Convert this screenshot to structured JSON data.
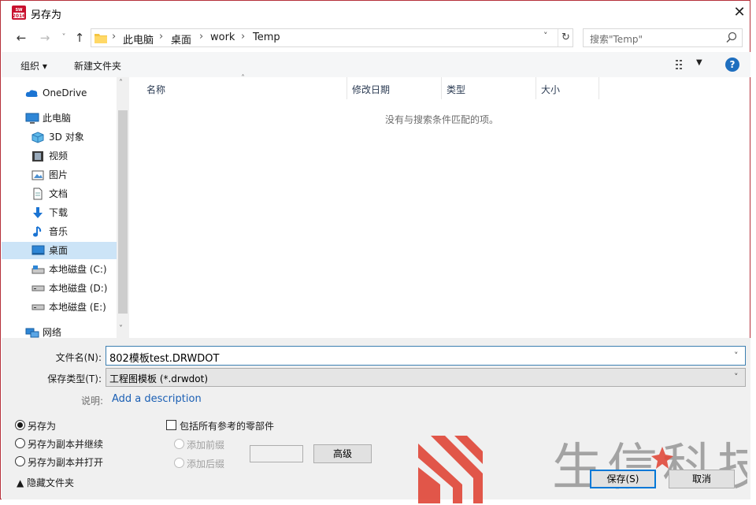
{
  "window": {
    "title": "另存为",
    "app_badge": "SW 2016"
  },
  "nav": {
    "breadcrumb": [
      "此电脑",
      "桌面",
      "work",
      "Temp"
    ],
    "search_placeholder": "搜索\"Temp\""
  },
  "toolbar": {
    "organize_label": "组织",
    "new_folder_label": "新建文件夹"
  },
  "sidebar": {
    "items": [
      {
        "label": "OneDrive",
        "icon": "cloud-icon"
      },
      {
        "label": "此电脑",
        "icon": "computer-icon"
      },
      {
        "label": "3D 对象",
        "icon": "3d-objects-icon"
      },
      {
        "label": "视频",
        "icon": "video-icon"
      },
      {
        "label": "图片",
        "icon": "pictures-icon"
      },
      {
        "label": "文档",
        "icon": "documents-icon"
      },
      {
        "label": "下载",
        "icon": "download-icon"
      },
      {
        "label": "音乐",
        "icon": "music-icon"
      },
      {
        "label": "桌面",
        "icon": "desktop-icon"
      },
      {
        "label": "本地磁盘 (C:)",
        "icon": "drive-c-icon"
      },
      {
        "label": "本地磁盘 (D:)",
        "icon": "drive-icon"
      },
      {
        "label": "本地磁盘 (E:)",
        "icon": "drive-icon"
      },
      {
        "label": "网络",
        "icon": "network-icon"
      }
    ]
  },
  "file_list": {
    "columns": [
      "名称",
      "修改日期",
      "类型",
      "大小"
    ],
    "empty_message": "没有与搜索条件匹配的项。"
  },
  "form": {
    "filename_label": "文件名(N):",
    "filename_value": "802模板test.DRWDOT",
    "filetype_label": "保存类型(T):",
    "filetype_value": "工程图模板 (*.drwdot)",
    "description_label": "说明:",
    "description_link": "Add a description"
  },
  "options": {
    "save_as": "另存为",
    "save_copy_continue": "另存为副本并继续",
    "save_copy_open": "另存为副本并打开",
    "include_refs": "包括所有参考的零部件",
    "add_prefix": "添加前缀",
    "add_suffix": "添加后缀",
    "advanced": "高级"
  },
  "footer": {
    "hide_folders": "隐藏文件夹",
    "save_button": "保存(S)",
    "cancel_button": "取消"
  },
  "watermark": {
    "text": "生信科技"
  },
  "colors": {
    "accent": "#0078d7",
    "window_border": "#b5303a",
    "selected_nav": "#cce4f7",
    "watermark_red": "#e0493b"
  }
}
